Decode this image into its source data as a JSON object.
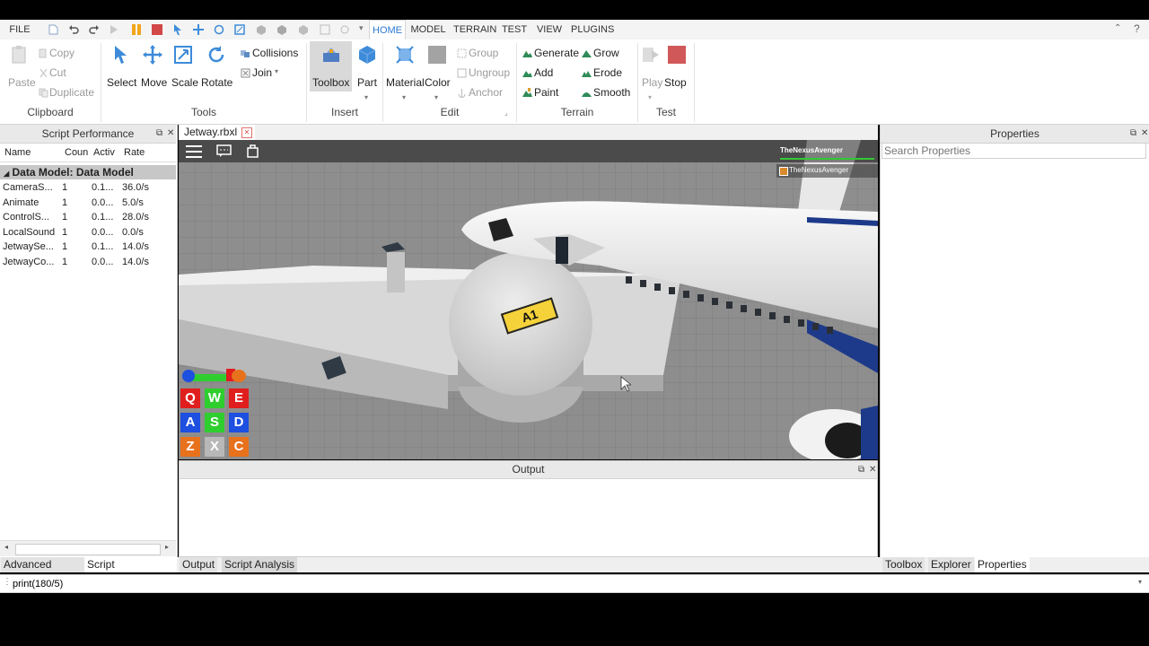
{
  "menu": {
    "file": "FILE"
  },
  "tabs": [
    {
      "label": "HOME",
      "active": true
    },
    {
      "label": "MODEL"
    },
    {
      "label": "TERRAIN"
    },
    {
      "label": "TEST"
    },
    {
      "label": "VIEW"
    },
    {
      "label": "PLUGINS"
    }
  ],
  "ribbon": {
    "clipboard": {
      "paste": "Paste",
      "copy": "Copy",
      "cut": "Cut",
      "duplicate": "Duplicate",
      "label": "Clipboard"
    },
    "tools": {
      "select": "Select",
      "move": "Move",
      "scale": "Scale",
      "rotate": "Rotate",
      "collisions": "Collisions",
      "join": "Join",
      "label": "Tools"
    },
    "insert": {
      "toolbox": "Toolbox",
      "part": "Part",
      "label": "Insert"
    },
    "edit": {
      "material": "Material",
      "color": "Color",
      "group": "Group",
      "ungroup": "Ungroup",
      "anchor": "Anchor",
      "label": "Edit"
    },
    "terrain": {
      "generate": "Generate",
      "add": "Add",
      "paint": "Paint",
      "grow": "Grow",
      "erode": "Erode",
      "smooth": "Smooth",
      "label": "Terrain"
    },
    "test": {
      "play": "Play",
      "stop": "Stop",
      "label": "Test"
    }
  },
  "script_performance": {
    "title": "Script Performance",
    "columns": [
      "Name",
      "Coun",
      "Activ",
      "Rate"
    ],
    "group": "Data Model: Data Model",
    "rows": [
      [
        "CameraS...",
        "1",
        "0.1...",
        "36.0/s"
      ],
      [
        "Animate",
        "1",
        "0.0...",
        "5.0/s"
      ],
      [
        "ControlS...",
        "1",
        "0.1...",
        "28.0/s"
      ],
      [
        "LocalSound",
        "1",
        "0.0...",
        "0.0/s"
      ],
      [
        "JetwaySe...",
        "1",
        "0.1...",
        "14.0/s"
      ],
      [
        "JetwayCo...",
        "1",
        "0.0...",
        "14.0/s"
      ]
    ]
  },
  "document": {
    "tab": "Jetway.rbxl"
  },
  "game": {
    "player": "TheNexusAvenger",
    "sign": "A1",
    "keys": [
      "Q",
      "W",
      "E",
      "A",
      "S",
      "D",
      "Z",
      "X",
      "C"
    ],
    "colors": {
      "red": "#e01e1e",
      "green": "#2fce2f",
      "blue": "#1d4fe0",
      "orange": "#e8711c",
      "gray": "#b8b8b8"
    }
  },
  "output": {
    "title": "Output"
  },
  "properties": {
    "title": "Properties",
    "search_placeholder": "Search Properties"
  },
  "bottom_tabs_left": [
    "Advanced Objects",
    "Script Performance",
    "Output",
    "Script Analysis"
  ],
  "bottom_tabs_right": [
    "Toolbox",
    "Explorer",
    "Properties"
  ],
  "command": {
    "value": "print(180/5)"
  },
  "accent": "#2b79d0"
}
